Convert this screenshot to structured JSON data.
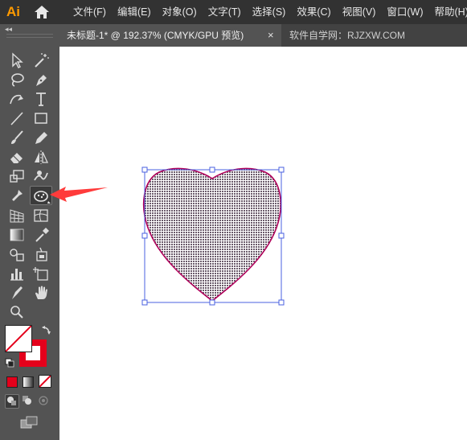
{
  "app": {
    "logo_text": "Ai"
  },
  "menu": {
    "items": [
      "文件(F)",
      "编辑(E)",
      "对象(O)",
      "文字(T)",
      "选择(S)",
      "效果(C)",
      "视图(V)",
      "窗口(W)",
      "帮助(H)"
    ]
  },
  "document": {
    "tab_title": "未标题-1* @ 192.37% (CMYK/GPU 预览)",
    "close_glyph": "×",
    "watermark_tab": "软件自学网：RJZXW.COM"
  },
  "toolbar": {
    "collapse_glyph": "◂◂",
    "tools": [
      "selection-tool",
      "magic-wand-tool",
      "lasso-tool",
      "pen-tool",
      "curvature-tool",
      "type-tool",
      "line-segment-tool",
      "rectangle-tool",
      "paintbrush-tool",
      "pencil-tool",
      "eraser-tool",
      "reflect-tool",
      "scale-tool",
      "warp-tool",
      "puppet-warp-tool",
      "symbol-sprayer-tool",
      "perspective-grid-tool",
      "mesh-tool",
      "gradient-tool",
      "eyedropper-tool",
      "blend-tool",
      "live-paint-tool",
      "column-graph-tool",
      "artboard-tool",
      "slice-tool",
      "hand-tool",
      "zoom-tool"
    ],
    "highlighted_tool": "symbol-sprayer-tool",
    "fill_color": "#ffffff",
    "stroke_color": "#e4001b"
  },
  "colors": {
    "menubar_bg": "#323232",
    "toolbar_bg": "#535353",
    "accent_orange": "#ff9a00",
    "heart_stroke": "#b0005a",
    "selection_blue": "#4a60e0",
    "annotation_arrow": "#ff3b3b"
  }
}
